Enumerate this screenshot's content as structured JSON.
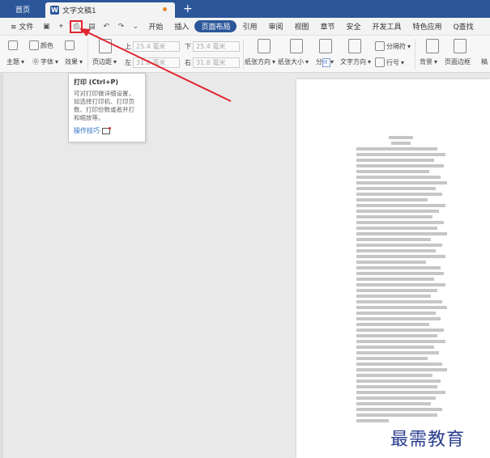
{
  "titlebar": {
    "home_tab": "首页",
    "doc_title": "文字文稿1",
    "doc_icon": "W",
    "add_tab": "+"
  },
  "menu": {
    "file": "≡ 文件",
    "items": [
      "开始",
      "插入",
      "页面布局",
      "引用",
      "审阅",
      "视图",
      "章节",
      "安全",
      "开发工具",
      "特色应用"
    ],
    "active_index": 2,
    "search": "Q查找"
  },
  "ribbon": {
    "theme": "主题",
    "color": "颜色",
    "font": "字体",
    "effect": "效果",
    "margins": "页边距",
    "margin_top_value": "25.4 毫米",
    "margin_bottom_value": "25.4 毫米",
    "margin_left_value": "31.8 毫米",
    "margin_right_value": "31.8 毫米",
    "top_label": "上",
    "bottom_label": "下",
    "left_label": "左",
    "right_label": "右",
    "orientation": "纸张方向",
    "size": "纸张大小",
    "columns": "分栏",
    "text_direction": "文字方向",
    "line_number": "行号",
    "break": "分隔符",
    "background": "背景",
    "page_border": "页面边框",
    "more": "稿"
  },
  "tooltip": {
    "title": "打印 (Ctrl+P)",
    "description": "可对打印做详细设置，如选择打印机、打印页数、打印份数或者并打和缩放等。",
    "link": "操作技巧"
  },
  "watermark": "最需教育",
  "colors": {
    "accent": "#2b579a",
    "highlight_border": "#e0262f",
    "arrow": "#e0262f"
  }
}
